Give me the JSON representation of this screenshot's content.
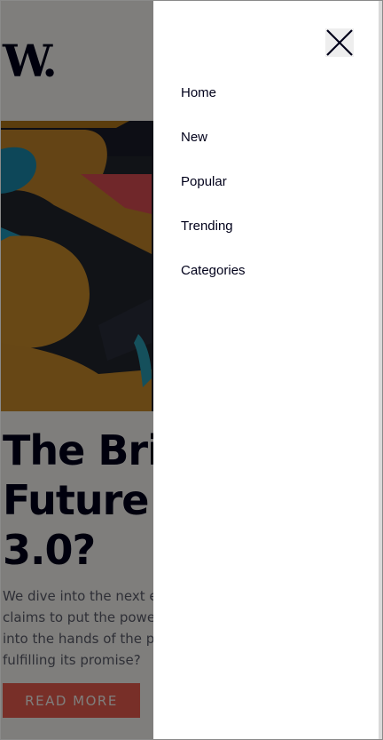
{
  "page": {
    "logo": "W.",
    "article_title_lines": [
      "The Brig",
      "Future o",
      "3.0?"
    ],
    "excerpt_lines": [
      "We dive into the next ev",
      "claims to put the power",
      "into the hands of the pe",
      "fulfilling its promise?"
    ],
    "read_more_label": "READ MORE"
  },
  "menu": {
    "close_icon": "close-icon",
    "items": [
      {
        "label": "Home"
      },
      {
        "label": "New"
      },
      {
        "label": "Popular"
      },
      {
        "label": "Trending"
      },
      {
        "label": "Categories"
      }
    ]
  },
  "colors": {
    "accent": "#f15e50",
    "dark_blue": "#00001a",
    "overlay": "rgba(0,0,0,0.5)"
  }
}
